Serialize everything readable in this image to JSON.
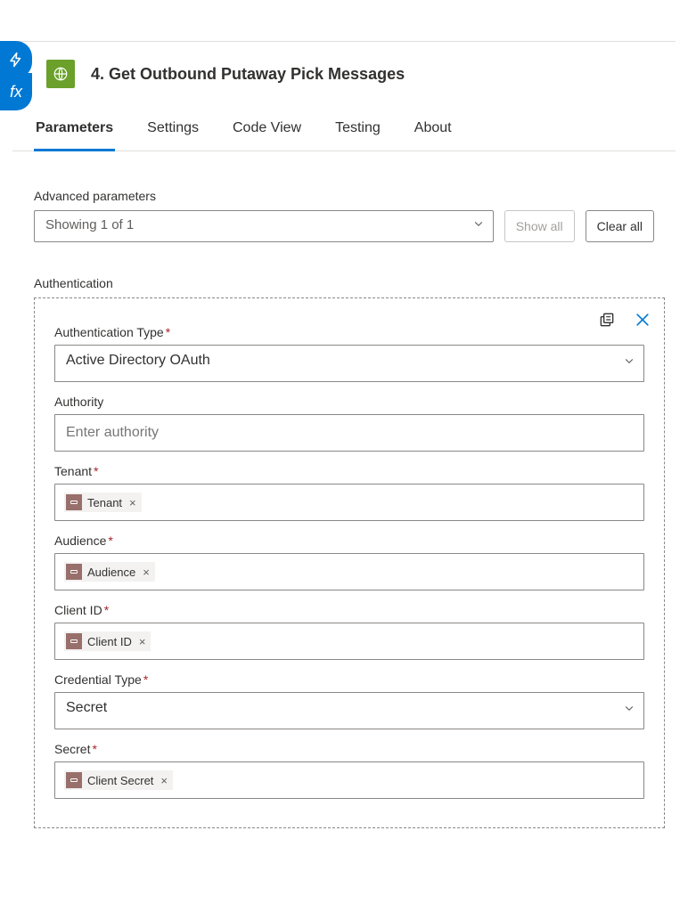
{
  "side_tabs": {
    "lightning_name": "lightning-icon",
    "fx_label": "fx"
  },
  "step": {
    "title": "4. Get Outbound Putaway Pick Messages"
  },
  "tabs": [
    {
      "label": "Parameters",
      "active": true
    },
    {
      "label": "Settings",
      "active": false
    },
    {
      "label": "Code View",
      "active": false
    },
    {
      "label": "Testing",
      "active": false
    },
    {
      "label": "About",
      "active": false
    }
  ],
  "advanced": {
    "heading": "Advanced parameters",
    "selected": "Showing 1 of 1",
    "show_all": "Show all",
    "clear_all": "Clear all"
  },
  "auth": {
    "section_label": "Authentication",
    "fields": {
      "auth_type": {
        "label": "Authentication Type",
        "required": true,
        "value": "Active Directory OAuth"
      },
      "authority": {
        "label": "Authority",
        "required": false,
        "placeholder": "Enter authority"
      },
      "tenant": {
        "label": "Tenant",
        "required": true,
        "token": "Tenant"
      },
      "audience": {
        "label": "Audience",
        "required": true,
        "token": "Audience"
      },
      "client_id": {
        "label": "Client ID",
        "required": true,
        "token": "Client ID"
      },
      "cred_type": {
        "label": "Credential Type",
        "required": true,
        "value": "Secret"
      },
      "secret": {
        "label": "Secret",
        "required": true,
        "token": "Client Secret"
      }
    }
  }
}
